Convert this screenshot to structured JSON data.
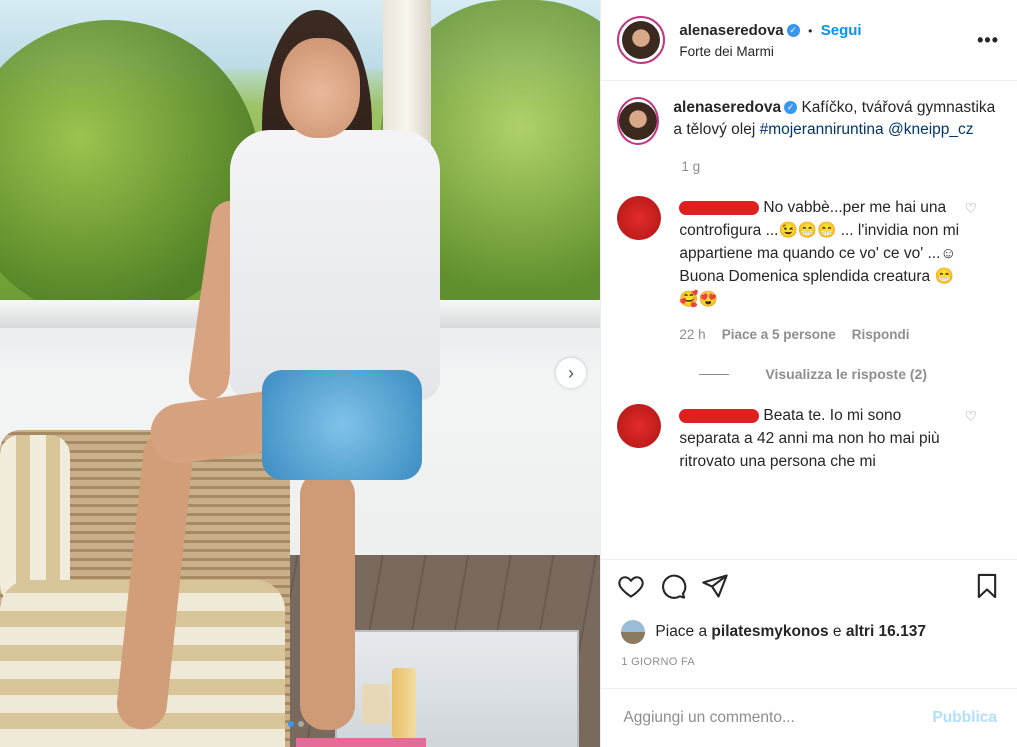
{
  "post": {
    "username": "alenaseredova",
    "follow_label": "Segui",
    "location": "Forte dei Marmi",
    "more_icon": "•••",
    "verified_glyph": "✓"
  },
  "caption": {
    "username": "alenaseredova",
    "text": "Kafíčko, tvářová gymnastika a tělový olej",
    "hashtag": "#mojeranniruntina",
    "mention": "@kneipp_cz",
    "time": "1 g"
  },
  "comments": [
    {
      "text": "No vabbè...per me hai una controfigura ...😉😁😁 ... l'invidia non mi appartiene ma quando ce vo' ce vo' ...☺ Buona Domenica splendida creatura 😁 🥰😍",
      "time": "22 h",
      "likes": "Piace a 5 persone",
      "reply": "Rispondi",
      "view_replies": "Visualizza le risposte (2)"
    },
    {
      "text": "Beata te. Io mi sono separata a 42 anni ma non ho mai più ritrovato una persona che mi"
    }
  ],
  "likes_row": {
    "prefix": "Piace a",
    "user": "pilatesmykonos",
    "mid": "e",
    "others": "altri 16.137"
  },
  "date": "1 GIORNO FA",
  "composer": {
    "placeholder": "Aggiungi un commento...",
    "publish": "Pubblica"
  },
  "carousel": {
    "next_glyph": "›",
    "slides": 2,
    "active": 0
  },
  "colors": {
    "accent": "#0095f6",
    "verified": "#3897f0",
    "muted": "#8e8e8e",
    "publish_disabled": "#b2dffc"
  }
}
